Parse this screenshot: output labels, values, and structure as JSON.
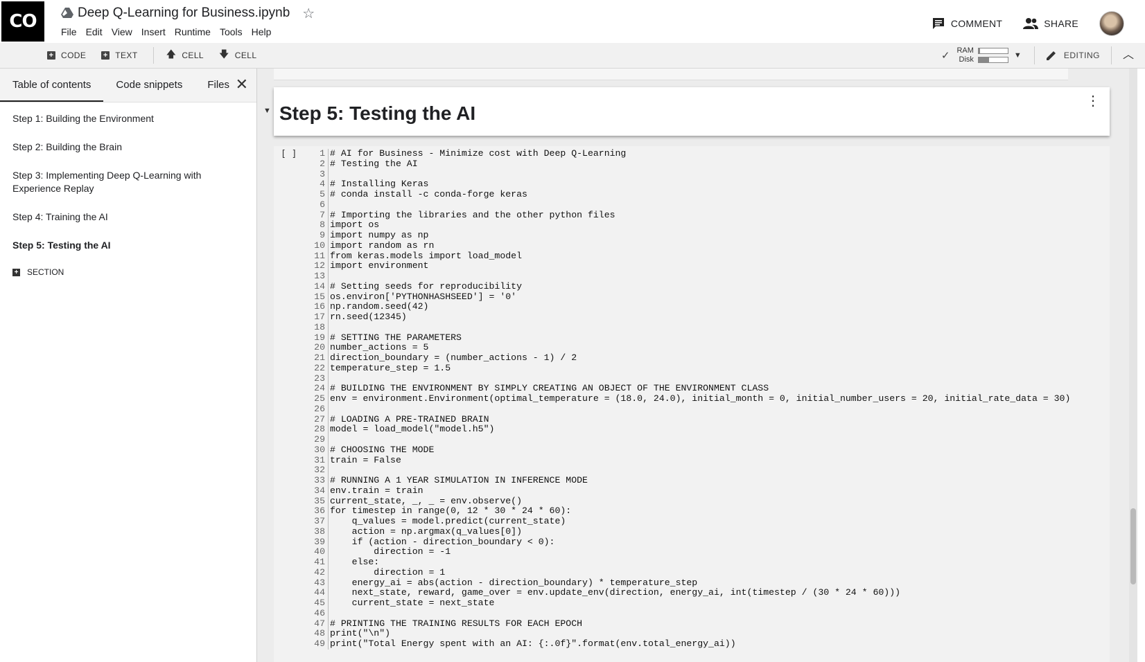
{
  "app": {
    "logo": "CO",
    "title": "Deep Q-Learning for Business.ipynb",
    "menu": [
      "File",
      "Edit",
      "View",
      "Insert",
      "Runtime",
      "Tools",
      "Help"
    ],
    "comment_label": "COMMENT",
    "share_label": "SHARE"
  },
  "toolbar": {
    "code_label": "CODE",
    "text_label": "TEXT",
    "cell_up_label": "CELL",
    "cell_down_label": "CELL",
    "ram_label": "RAM",
    "disk_label": "Disk",
    "ram_usage": 0.05,
    "disk_usage": 0.35,
    "editing_label": "EDITING"
  },
  "sidebar": {
    "tabs": [
      "Table of contents",
      "Code snippets",
      "Files"
    ],
    "active_tab": 0,
    "toc": [
      "Step 1: Building the Environment",
      "Step 2: Building the Brain",
      "Step 3: Implementing Deep Q-Learning with Experience Replay",
      "Step 4: Training the AI",
      "Step 5: Testing the AI"
    ],
    "active_toc": 4,
    "section_label": "SECTION"
  },
  "notebook": {
    "heading": "Step 5: Testing the AI",
    "run_indicator": "[ ]",
    "scroll_position": 0.85,
    "code_lines": [
      "# AI for Business - Minimize cost with Deep Q-Learning",
      "# Testing the AI",
      "",
      "# Installing Keras",
      "# conda install -c conda-forge keras",
      "",
      "# Importing the libraries and the other python files",
      "import os",
      "import numpy as np",
      "import random as rn",
      "from keras.models import load_model",
      "import environment",
      "",
      "# Setting seeds for reproducibility",
      "os.environ['PYTHONHASHSEED'] = '0'",
      "np.random.seed(42)",
      "rn.seed(12345)",
      "",
      "# SETTING THE PARAMETERS",
      "number_actions = 5",
      "direction_boundary = (number_actions - 1) / 2",
      "temperature_step = 1.5",
      "",
      "# BUILDING THE ENVIRONMENT BY SIMPLY CREATING AN OBJECT OF THE ENVIRONMENT CLASS",
      "env = environment.Environment(optimal_temperature = (18.0, 24.0), initial_month = 0, initial_number_users = 20, initial_rate_data = 30)",
      "",
      "# LOADING A PRE-TRAINED BRAIN",
      "model = load_model(\"model.h5\")",
      "",
      "# CHOOSING THE MODE",
      "train = False",
      "",
      "# RUNNING A 1 YEAR SIMULATION IN INFERENCE MODE",
      "env.train = train",
      "current_state, _, _ = env.observe()",
      "for timestep in range(0, 12 * 30 * 24 * 60):",
      "    q_values = model.predict(current_state)",
      "    action = np.argmax(q_values[0])",
      "    if (action - direction_boundary < 0):",
      "        direction = -1",
      "    else:",
      "        direction = 1",
      "    energy_ai = abs(action - direction_boundary) * temperature_step",
      "    next_state, reward, game_over = env.update_env(direction, energy_ai, int(timestep / (30 * 24 * 60)))",
      "    current_state = next_state",
      "",
      "# PRINTING THE TRAINING RESULTS FOR EACH EPOCH",
      "print(\"\\n\")",
      "print(\"Total Energy spent with an AI: {:.0f}\".format(env.total_energy_ai))"
    ]
  }
}
